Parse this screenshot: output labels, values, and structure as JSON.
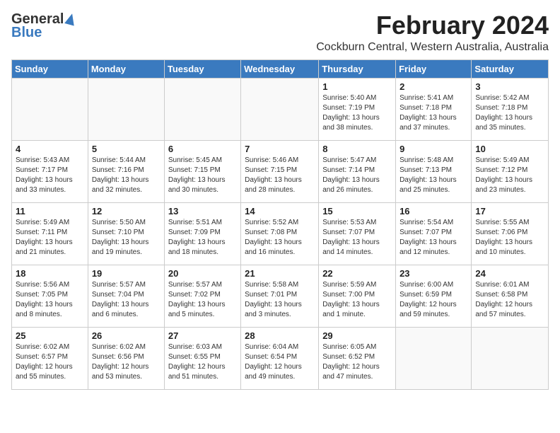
{
  "logo": {
    "general": "General",
    "blue": "Blue"
  },
  "header": {
    "month": "February 2024",
    "location": "Cockburn Central, Western Australia, Australia"
  },
  "weekdays": [
    "Sunday",
    "Monday",
    "Tuesday",
    "Wednesday",
    "Thursday",
    "Friday",
    "Saturday"
  ],
  "weeks": [
    [
      {
        "day": "",
        "sunrise": "",
        "sunset": "",
        "daylight": ""
      },
      {
        "day": "",
        "sunrise": "",
        "sunset": "",
        "daylight": ""
      },
      {
        "day": "",
        "sunrise": "",
        "sunset": "",
        "daylight": ""
      },
      {
        "day": "",
        "sunrise": "",
        "sunset": "",
        "daylight": ""
      },
      {
        "day": "1",
        "sunrise": "Sunrise: 5:40 AM",
        "sunset": "Sunset: 7:19 PM",
        "daylight": "Daylight: 13 hours and 38 minutes."
      },
      {
        "day": "2",
        "sunrise": "Sunrise: 5:41 AM",
        "sunset": "Sunset: 7:18 PM",
        "daylight": "Daylight: 13 hours and 37 minutes."
      },
      {
        "day": "3",
        "sunrise": "Sunrise: 5:42 AM",
        "sunset": "Sunset: 7:18 PM",
        "daylight": "Daylight: 13 hours and 35 minutes."
      }
    ],
    [
      {
        "day": "4",
        "sunrise": "Sunrise: 5:43 AM",
        "sunset": "Sunset: 7:17 PM",
        "daylight": "Daylight: 13 hours and 33 minutes."
      },
      {
        "day": "5",
        "sunrise": "Sunrise: 5:44 AM",
        "sunset": "Sunset: 7:16 PM",
        "daylight": "Daylight: 13 hours and 32 minutes."
      },
      {
        "day": "6",
        "sunrise": "Sunrise: 5:45 AM",
        "sunset": "Sunset: 7:15 PM",
        "daylight": "Daylight: 13 hours and 30 minutes."
      },
      {
        "day": "7",
        "sunrise": "Sunrise: 5:46 AM",
        "sunset": "Sunset: 7:15 PM",
        "daylight": "Daylight: 13 hours and 28 minutes."
      },
      {
        "day": "8",
        "sunrise": "Sunrise: 5:47 AM",
        "sunset": "Sunset: 7:14 PM",
        "daylight": "Daylight: 13 hours and 26 minutes."
      },
      {
        "day": "9",
        "sunrise": "Sunrise: 5:48 AM",
        "sunset": "Sunset: 7:13 PM",
        "daylight": "Daylight: 13 hours and 25 minutes."
      },
      {
        "day": "10",
        "sunrise": "Sunrise: 5:49 AM",
        "sunset": "Sunset: 7:12 PM",
        "daylight": "Daylight: 13 hours and 23 minutes."
      }
    ],
    [
      {
        "day": "11",
        "sunrise": "Sunrise: 5:49 AM",
        "sunset": "Sunset: 7:11 PM",
        "daylight": "Daylight: 13 hours and 21 minutes."
      },
      {
        "day": "12",
        "sunrise": "Sunrise: 5:50 AM",
        "sunset": "Sunset: 7:10 PM",
        "daylight": "Daylight: 13 hours and 19 minutes."
      },
      {
        "day": "13",
        "sunrise": "Sunrise: 5:51 AM",
        "sunset": "Sunset: 7:09 PM",
        "daylight": "Daylight: 13 hours and 18 minutes."
      },
      {
        "day": "14",
        "sunrise": "Sunrise: 5:52 AM",
        "sunset": "Sunset: 7:08 PM",
        "daylight": "Daylight: 13 hours and 16 minutes."
      },
      {
        "day": "15",
        "sunrise": "Sunrise: 5:53 AM",
        "sunset": "Sunset: 7:07 PM",
        "daylight": "Daylight: 13 hours and 14 minutes."
      },
      {
        "day": "16",
        "sunrise": "Sunrise: 5:54 AM",
        "sunset": "Sunset: 7:07 PM",
        "daylight": "Daylight: 13 hours and 12 minutes."
      },
      {
        "day": "17",
        "sunrise": "Sunrise: 5:55 AM",
        "sunset": "Sunset: 7:06 PM",
        "daylight": "Daylight: 13 hours and 10 minutes."
      }
    ],
    [
      {
        "day": "18",
        "sunrise": "Sunrise: 5:56 AM",
        "sunset": "Sunset: 7:05 PM",
        "daylight": "Daylight: 13 hours and 8 minutes."
      },
      {
        "day": "19",
        "sunrise": "Sunrise: 5:57 AM",
        "sunset": "Sunset: 7:04 PM",
        "daylight": "Daylight: 13 hours and 6 minutes."
      },
      {
        "day": "20",
        "sunrise": "Sunrise: 5:57 AM",
        "sunset": "Sunset: 7:02 PM",
        "daylight": "Daylight: 13 hours and 5 minutes."
      },
      {
        "day": "21",
        "sunrise": "Sunrise: 5:58 AM",
        "sunset": "Sunset: 7:01 PM",
        "daylight": "Daylight: 13 hours and 3 minutes."
      },
      {
        "day": "22",
        "sunrise": "Sunrise: 5:59 AM",
        "sunset": "Sunset: 7:00 PM",
        "daylight": "Daylight: 13 hours and 1 minute."
      },
      {
        "day": "23",
        "sunrise": "Sunrise: 6:00 AM",
        "sunset": "Sunset: 6:59 PM",
        "daylight": "Daylight: 12 hours and 59 minutes."
      },
      {
        "day": "24",
        "sunrise": "Sunrise: 6:01 AM",
        "sunset": "Sunset: 6:58 PM",
        "daylight": "Daylight: 12 hours and 57 minutes."
      }
    ],
    [
      {
        "day": "25",
        "sunrise": "Sunrise: 6:02 AM",
        "sunset": "Sunset: 6:57 PM",
        "daylight": "Daylight: 12 hours and 55 minutes."
      },
      {
        "day": "26",
        "sunrise": "Sunrise: 6:02 AM",
        "sunset": "Sunset: 6:56 PM",
        "daylight": "Daylight: 12 hours and 53 minutes."
      },
      {
        "day": "27",
        "sunrise": "Sunrise: 6:03 AM",
        "sunset": "Sunset: 6:55 PM",
        "daylight": "Daylight: 12 hours and 51 minutes."
      },
      {
        "day": "28",
        "sunrise": "Sunrise: 6:04 AM",
        "sunset": "Sunset: 6:54 PM",
        "daylight": "Daylight: 12 hours and 49 minutes."
      },
      {
        "day": "29",
        "sunrise": "Sunrise: 6:05 AM",
        "sunset": "Sunset: 6:52 PM",
        "daylight": "Daylight: 12 hours and 47 minutes."
      },
      {
        "day": "",
        "sunrise": "",
        "sunset": "",
        "daylight": ""
      },
      {
        "day": "",
        "sunrise": "",
        "sunset": "",
        "daylight": ""
      }
    ]
  ]
}
